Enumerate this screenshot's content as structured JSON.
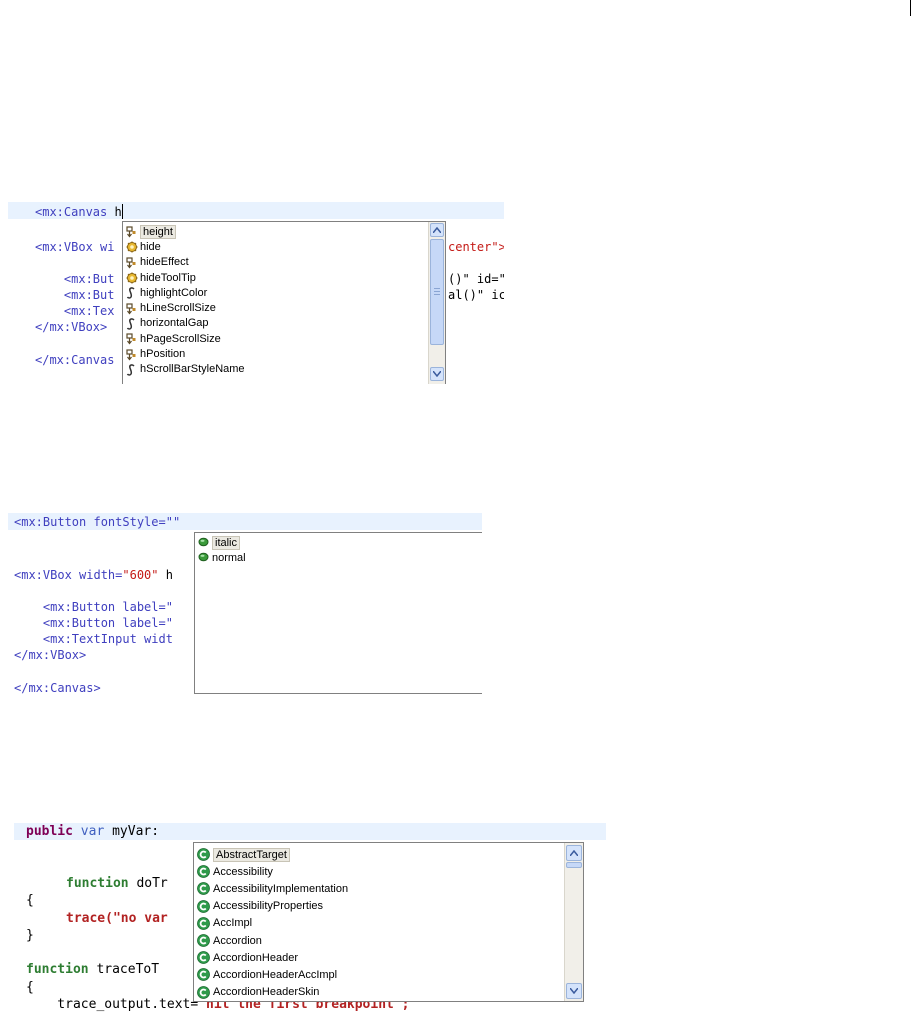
{
  "panel1": {
    "lines": {
      "canvas_prefix": "<mx:Canvas",
      "canvas_typed": " h",
      "vbox_start": "<mx:VBox wi",
      "vbox_tail": "center\">",
      "button1": "    <mx:But",
      "button1_tail": "()\" id=\"",
      "button2": "    <mx:But",
      "button2_tail": "al()\" ic",
      "text1": "    <mx:Tex",
      "vbox_close": "</mx:VBox>",
      "canvas_close": "</mx:Canvas"
    },
    "suggestions": [
      {
        "label": "height",
        "icon": "property-icon"
      },
      {
        "label": "hide",
        "icon": "event-icon"
      },
      {
        "label": "hideEffect",
        "icon": "property-icon"
      },
      {
        "label": "hideToolTip",
        "icon": "event-icon"
      },
      {
        "label": "highlightColor",
        "icon": "style-icon"
      },
      {
        "label": "hLineScrollSize",
        "icon": "property-icon"
      },
      {
        "label": "horizontalGap",
        "icon": "style-icon"
      },
      {
        "label": "hPageScrollSize",
        "icon": "property-icon"
      },
      {
        "label": "hPosition",
        "icon": "property-icon"
      },
      {
        "label": "hScrollBarStyleName",
        "icon": "style-icon"
      }
    ]
  },
  "panel2": {
    "lines": {
      "button_start": "<mx:Button fontStyle=\"\"",
      "vbox_a": "<mx:VBox width=",
      "vbox_val": "\"600\"",
      "vbox_b": " h",
      "button1": "    <mx:Button label=\"",
      "button2": "    <mx:Button label=\"",
      "textinput": "    <mx:TextInput widt",
      "vbox_close": "</mx:VBox>",
      "canvas_close": "</mx:Canvas>"
    },
    "suggestions": [
      {
        "label": "italic",
        "icon": "enum-value-icon"
      },
      {
        "label": "normal",
        "icon": "enum-value-icon"
      }
    ]
  },
  "panel3": {
    "lines": {
      "kw_public": "public",
      "kw_var": "var",
      "var_decl": " myVar:",
      "fn_kw": "function",
      "fn_name": " doTr",
      "brace_open": "{",
      "trace_fn": "trace",
      "trace_str": "(\"no var",
      "brace_close": "}",
      "fn2_kw": "function",
      "fn2_name": " traceToT",
      "brace_open2": "{",
      "trace_output": "    trace_output.text=",
      "trace_output_str": "\"hit the first breakpoint\";"
    },
    "suggestions": [
      {
        "label": "AbstractTarget",
        "icon": "class-icon"
      },
      {
        "label": "Accessibility",
        "icon": "class-icon"
      },
      {
        "label": "AccessibilityImplementation",
        "icon": "class-icon"
      },
      {
        "label": "AccessibilityProperties",
        "icon": "class-icon"
      },
      {
        "label": "AccImpl",
        "icon": "class-icon"
      },
      {
        "label": "Accordion",
        "icon": "class-icon"
      },
      {
        "label": "AccordionHeader",
        "icon": "class-icon"
      },
      {
        "label": "AccordionHeaderAccImpl",
        "icon": "class-icon"
      },
      {
        "label": "AccordionHeaderSkin",
        "icon": "class-icon"
      }
    ]
  },
  "colors": {
    "line_highlight": "#e8f2fe",
    "selection": "#ebe9e1",
    "scrollbar_button": "#d4e3fb",
    "class_icon": "#2e9a4a",
    "enum_icon": "#3a9a3a"
  }
}
